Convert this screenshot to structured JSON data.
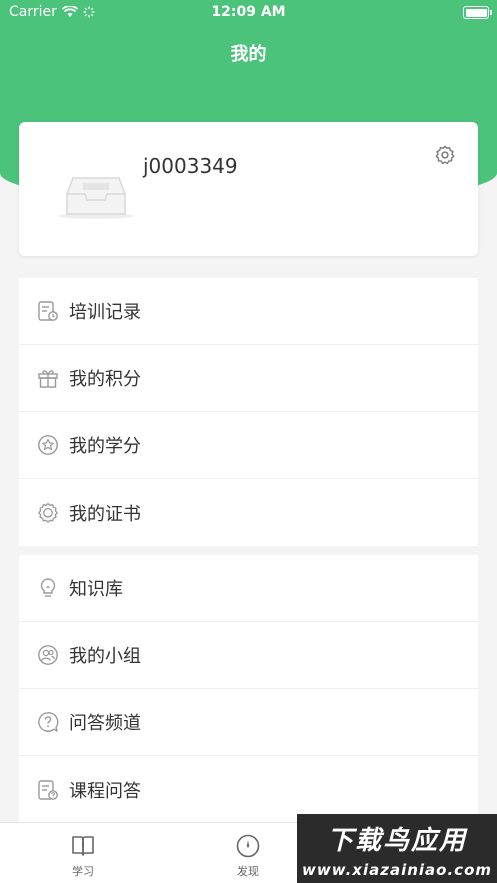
{
  "status_bar": {
    "carrier": "Carrier",
    "time": "12:09 AM"
  },
  "header": {
    "title": "我的"
  },
  "profile": {
    "username": "j0003349"
  },
  "menu_group_1": [
    {
      "label": "培训记录",
      "icon": "training-record-icon"
    },
    {
      "label": "我的积分",
      "icon": "gift-icon"
    },
    {
      "label": "我的学分",
      "icon": "star-icon"
    },
    {
      "label": "我的证书",
      "icon": "certificate-icon"
    }
  ],
  "menu_group_2": [
    {
      "label": "知识库",
      "icon": "lightbulb-icon"
    },
    {
      "label": "我的小组",
      "icon": "group-icon"
    },
    {
      "label": "问答频道",
      "icon": "question-icon"
    },
    {
      "label": "课程问答",
      "icon": "course-qa-icon"
    }
  ],
  "tabbar": {
    "tab_study": "学习",
    "tab_discover": "发现"
  },
  "watermark": {
    "line1": "下载鸟应用",
    "line2": "www.xiazainiao.com"
  },
  "colors": {
    "accent": "#4cc37a",
    "icon": "#999999"
  }
}
